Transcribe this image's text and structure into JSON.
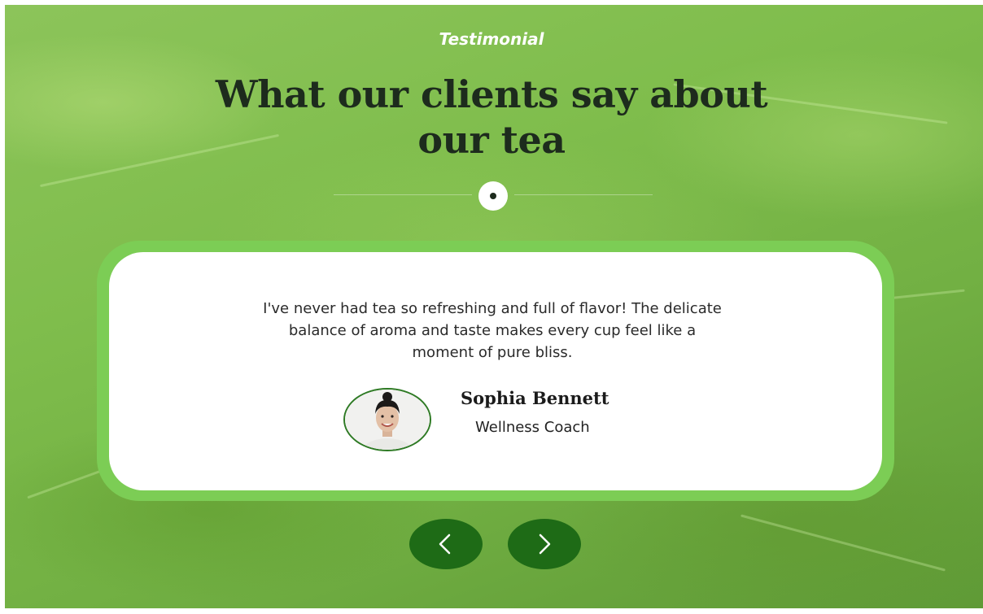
{
  "section": {
    "eyebrow": "Testimonial",
    "heading_line1": "What our clients say about",
    "heading_line2": "our tea"
  },
  "testimonial": {
    "quote_line1": "I've never had tea so refreshing and full of flavor! The delicate",
    "quote_line2": "balance of aroma and taste makes every cup feel like a",
    "quote_line3": "moment of pure bliss.",
    "author_name": "Sophia Bennett",
    "author_role": "Wellness Coach",
    "avatar_icon": "avatar-portrait"
  },
  "navigation": {
    "prev_icon": "chevron-left-icon",
    "next_icon": "chevron-right-icon"
  },
  "colors": {
    "accent_green": "#7ccd55",
    "button_green": "#1e6b16",
    "heading_dark": "#1d2b1d",
    "background_green": "#7fbd4c"
  }
}
